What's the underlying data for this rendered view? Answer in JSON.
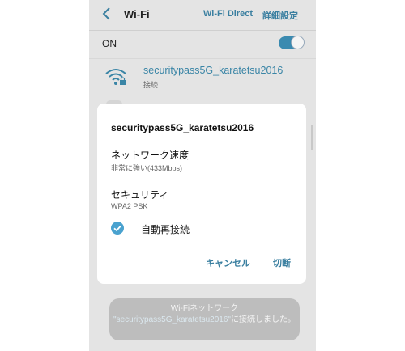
{
  "header": {
    "title": "Wi-Fi",
    "wifi_direct": "Wi-Fi Direct",
    "advanced": "詳細設定"
  },
  "master_switch": {
    "label": "ON",
    "state": "on"
  },
  "network": {
    "name": "securitypass5G_karatetsu2016",
    "status": "接続"
  },
  "dialog": {
    "title": "securitypass5G_karatetsu2016",
    "speed_label": "ネットワーク速度",
    "speed_value": "非常に強い(433Mbps)",
    "security_label": "セキュリティ",
    "security_value": "WPA2 PSK",
    "auto_reconnect_label": "自動再接続",
    "auto_reconnect_checked": true,
    "cancel_label": "キャンセル",
    "disconnect_label": "切断"
  },
  "toast": {
    "prefix": "Wi-Fiネットワーク",
    "network": "\"securitypass5G_karatetsu2016\"",
    "suffix": "に接続しました。"
  },
  "colors": {
    "accent": "#3a7fa0",
    "background": "#e4e4e4",
    "checkbox": "#4aa2cf"
  }
}
